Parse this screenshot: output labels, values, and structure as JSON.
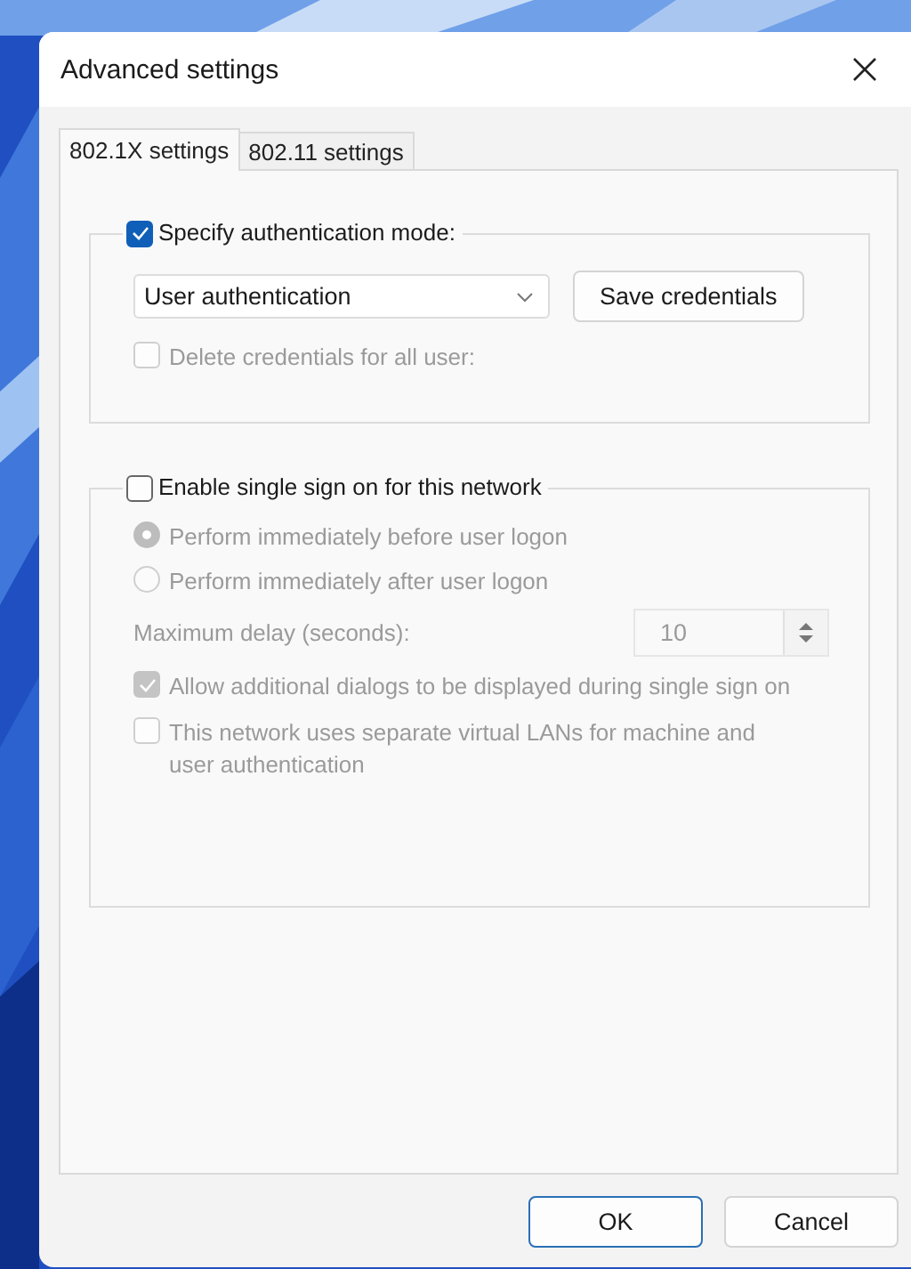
{
  "window": {
    "title": "Advanced settings"
  },
  "tabs": [
    {
      "label": "802.1X settings",
      "selected": true
    },
    {
      "label": "802.11 settings",
      "selected": false
    }
  ],
  "auth_group": {
    "label": "Specify authentication mode:",
    "checked": true,
    "mode": {
      "value": "User authentication"
    },
    "save_button": "Save credentials",
    "delete_option": {
      "label": "Delete credentials for all user:",
      "checked": false,
      "disabled": true
    }
  },
  "sso_group": {
    "label": "Enable single sign on for this network",
    "checked": false,
    "options": [
      {
        "kind": "radio",
        "label": "Perform immediately before user logon",
        "selected": true,
        "disabled": true
      },
      {
        "kind": "radio",
        "label": "Perform immediately after user logon",
        "selected": false,
        "disabled": true
      },
      {
        "kind": "spin",
        "label": "Maximum delay (seconds):",
        "value": "10",
        "disabled": true
      },
      {
        "kind": "checkbox",
        "label": "Allow additional dialogs to be displayed during single sign on",
        "checked": true,
        "disabled": true
      },
      {
        "kind": "checkbox",
        "label": "This network uses separate virtual LANs for machine and user authentication",
        "checked": false,
        "disabled": true
      }
    ]
  },
  "buttons": [
    {
      "label": "OK",
      "default": true
    },
    {
      "label": "Cancel",
      "default": false
    }
  ]
}
